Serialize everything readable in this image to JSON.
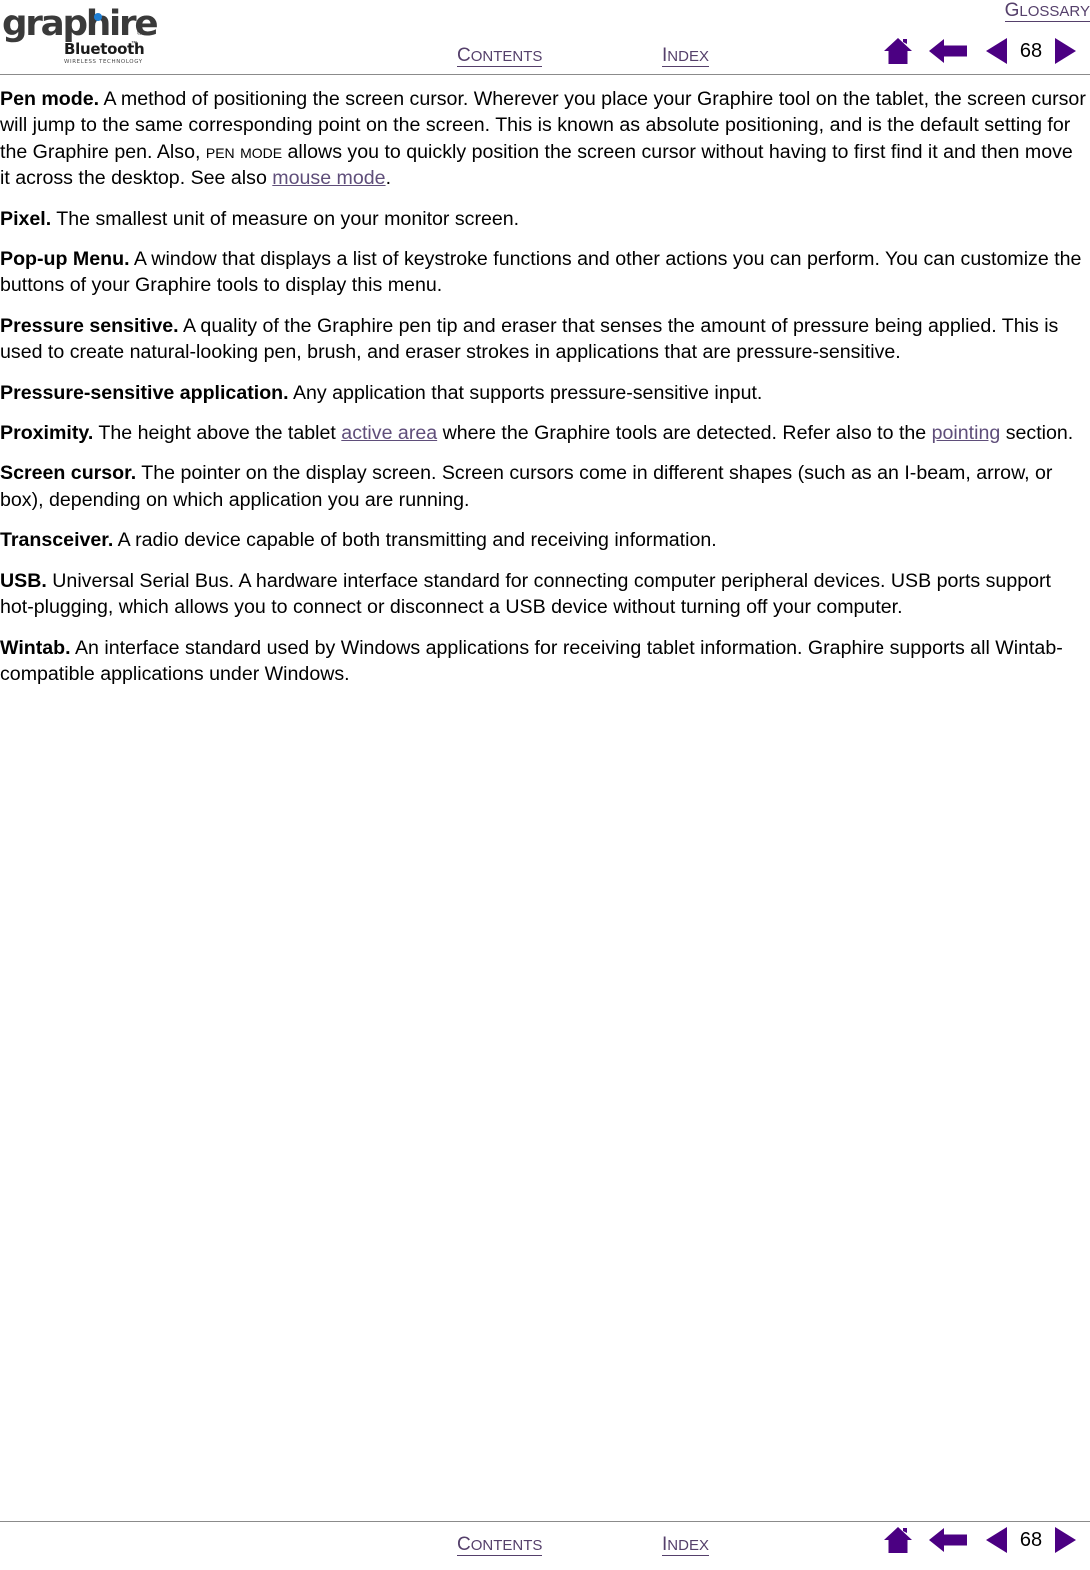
{
  "logo": {
    "wordmark": "graphire",
    "registered": "®",
    "bluetooth": "Bluetooth",
    "bluetooth_tm": "™",
    "tagline": "WIRELESS TECHNOLOGY",
    "dot_color": "#1f7fd4",
    "wordmark_color": "#3a3a3a"
  },
  "nav": {
    "glossary": {
      "cap": "G",
      "rest": "LOSSARY",
      "full": "GLOSSARY"
    },
    "contents": {
      "cap": "C",
      "rest": "ONTENTS",
      "full": "CONTENTS"
    },
    "index": {
      "cap": "I",
      "rest": "NDEX",
      "full": "INDEX"
    },
    "page_number": "68",
    "icons": {
      "home": "home-icon",
      "back": "back-arrow-icon",
      "previous": "previous-page-icon",
      "next": "next-page-icon"
    },
    "accent_color": "#4b0082",
    "link_color": "#55406b"
  },
  "body": {
    "entries": [
      {
        "term": "Pen mode.",
        "parts": [
          {
            "type": "text",
            "value": "  A method of positioning the screen cursor.  Wherever you place your Graphire tool on the tablet, the screen cursor will jump to the same corresponding point on the screen.  This is known as absolute positioning, and is the default setting for the Graphire pen.  Also, "
          },
          {
            "type": "smallcaps",
            "value": "Pen Mode"
          },
          {
            "type": "text",
            "value": " allows you to quickly position the screen cursor without having to first find it and then move it across the desktop.  See also "
          },
          {
            "type": "link",
            "value": "mouse mode"
          },
          {
            "type": "text",
            "value": "."
          }
        ]
      },
      {
        "term": "Pixel.",
        "parts": [
          {
            "type": "text",
            "value": "  The smallest unit of measure on your monitor screen."
          }
        ]
      },
      {
        "term": "Pop-up Menu.",
        "parts": [
          {
            "type": "text",
            "value": "  A window that displays a list of keystroke functions and other actions you can perform.  You can customize the buttons of your Graphire tools to display this menu."
          }
        ]
      },
      {
        "term": "Pressure sensitive.",
        "parts": [
          {
            "type": "text",
            "value": "  A quality of the Graphire pen tip and eraser that senses the amount of pressure being applied.  This is used to create natural-looking pen, brush, and eraser strokes in applications that are pressure-sensitive."
          }
        ]
      },
      {
        "term": "Pressure-sensitive application.",
        "parts": [
          {
            "type": "text",
            "value": "  Any application that supports pressure-sensitive input."
          }
        ]
      },
      {
        "term": "Proximity.",
        "parts": [
          {
            "type": "text",
            "value": "  The height above the tablet "
          },
          {
            "type": "link",
            "value": "active area"
          },
          {
            "type": "text",
            "value": " where the Graphire tools are detected.  Refer also to the "
          },
          {
            "type": "link",
            "value": "pointing"
          },
          {
            "type": "text",
            "value": " section."
          }
        ]
      },
      {
        "term": "Screen cursor.",
        "parts": [
          {
            "type": "text",
            "value": "  The pointer on the display screen.  Screen cursors come in different shapes (such as an I-beam, arrow, or box), depending on which application you are running."
          }
        ]
      },
      {
        "term": "Transceiver.",
        "parts": [
          {
            "type": "text",
            "value": "  A radio device capable of both transmitting and receiving information."
          }
        ]
      },
      {
        "term": "USB.",
        "parts": [
          {
            "type": "text",
            "value": "  Universal Serial Bus.  A hardware interface standard for connecting computer peripheral devices.  USB ports support hot-plugging, which allows you to connect or disconnect a USB device without turning off your computer."
          }
        ]
      },
      {
        "term": "Wintab.",
        "parts": [
          {
            "type": "text",
            "value": "  An interface standard used by Windows applications for receiving tablet information.  Graphire supports all Wintab-compatible applications under Windows."
          }
        ]
      }
    ]
  }
}
